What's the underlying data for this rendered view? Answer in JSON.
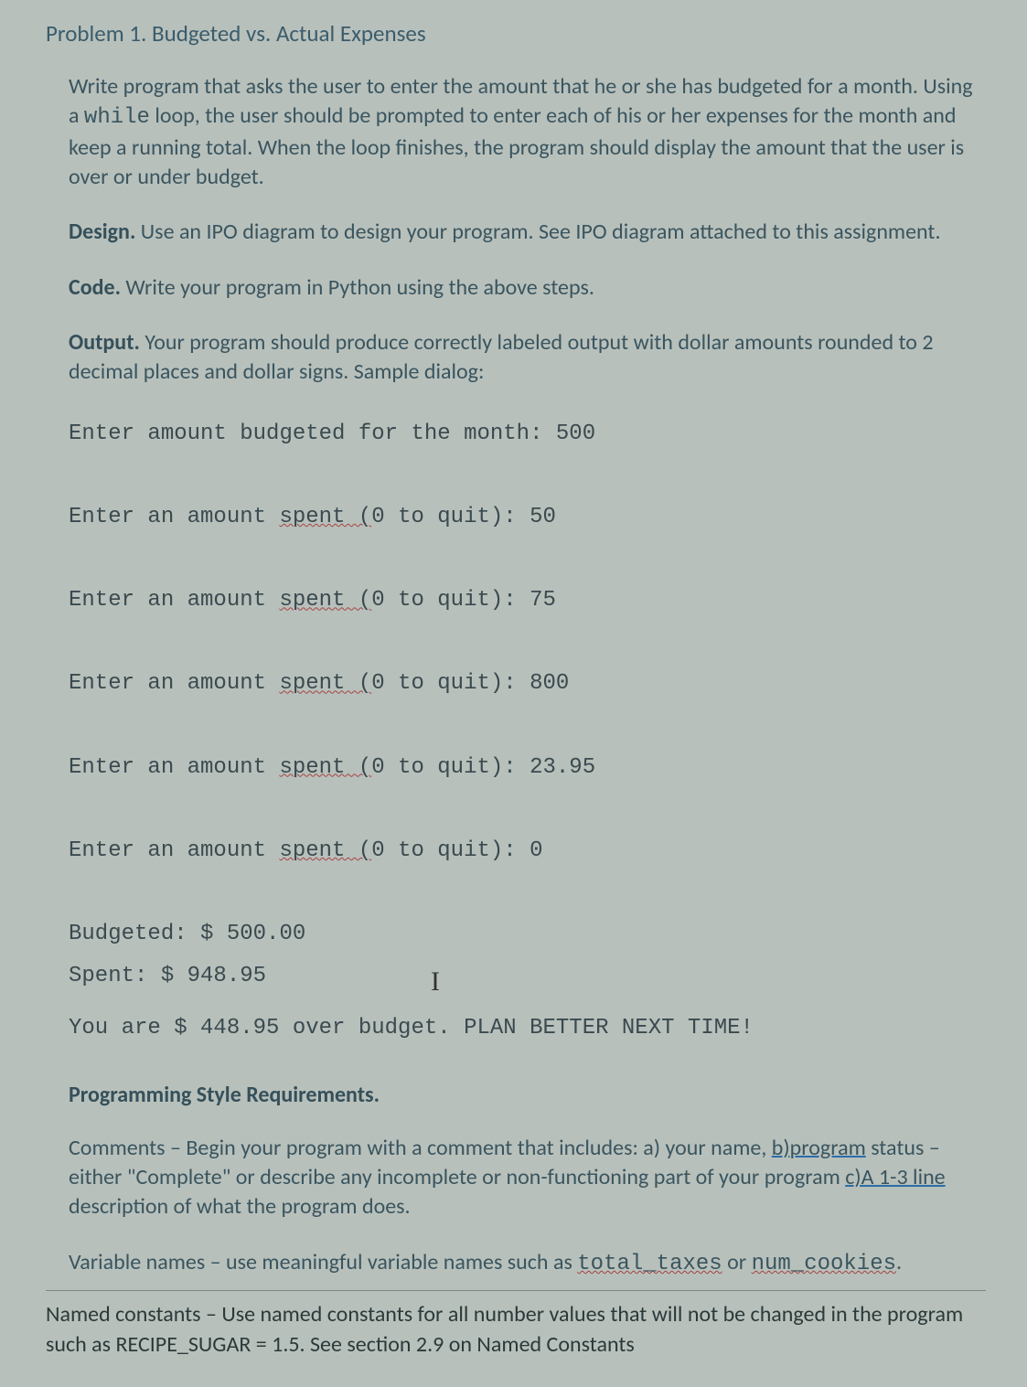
{
  "title": "Problem 1.  Budgeted vs. Actual Expenses",
  "intro": "Write program that asks the user to enter the amount that he or she has budgeted for a month. Using a ",
  "while_kw": "while",
  "intro2": " loop, the user should be prompted to enter each of his or her expenses for the month and keep a running total. When the loop finishes, the program should display the amount that the user is over or under budget.",
  "design_label": "Design.",
  "design_text": " Use an IPO diagram to design your program. See IPO diagram attached to this assignment.",
  "code_label": "Code.",
  "code_text": "  Write your program in Python using the above steps.",
  "output_label": "Output.",
  "output_text": " Your program should produce correctly labeled output with dollar amounts rounded to 2 decimal places and dollar signs.  Sample dialog:",
  "dialog": {
    "l1a": "Enter amount budgeted for the month: 500",
    "l2a": "Enter an amount ",
    "spent": "spent (",
    "l2b": "0 to quit): 50",
    "l3b": "0 to quit): 75",
    "l4b": "0 to quit): 800",
    "l5b": "0 to quit): 23.95",
    "l6b": "0 to quit): 0",
    "l7": "Budgeted: $ 500.00",
    "l8": "Spent: $ 948.95",
    "cursor": "I",
    "l9": "You are $ 448.95 over budget. PLAN BETTER NEXT TIME!"
  },
  "style_head": "Programming Style Requirements.",
  "comments1": "Comments – Begin your program with a comment that includes: a) your name, ",
  "comments_b": "b)program",
  "comments2": " status – either \"Complete\" or describe any incomplete or non-functioning part of your program ",
  "comments_c": "c)A",
  "comments_c2": " 1-3 line",
  "comments3": " description of what the program does.",
  "varnames1": "Variable names – use meaningful variable names such as ",
  "taxes": "total_taxes",
  "or": " or ",
  "cookies": "num_cookies",
  "period": ".",
  "named": "Named constants – Use named constants for all number values that will not be changed in the program such as RECIPE_SUGAR = 1.5.   See section 2.9 on Named Constants"
}
